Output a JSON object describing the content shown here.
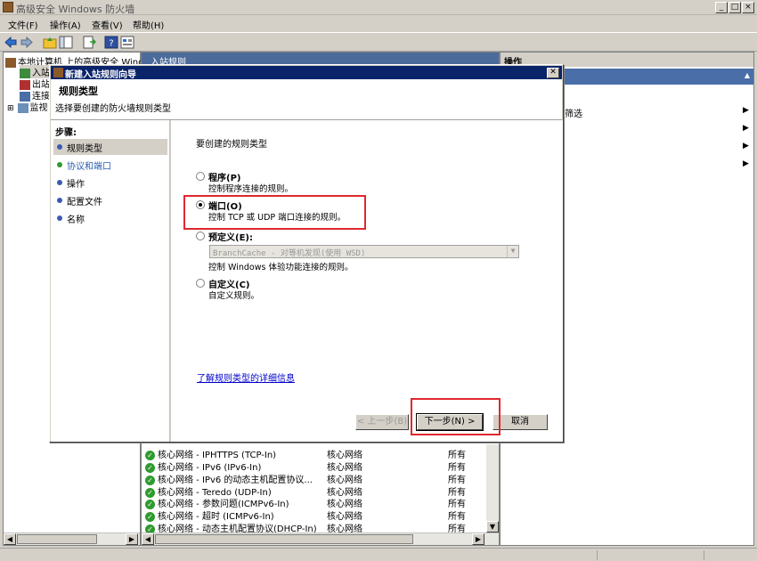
{
  "window": {
    "title": "高级安全 Windows 防火墙",
    "controls": [
      "_",
      "□",
      "×"
    ]
  },
  "menu": [
    "文件(F)",
    "操作(A)",
    "查看(V)",
    "帮助(H)"
  ],
  "tree": {
    "root": "本地计算机 上的高级安全 Wind",
    "children": [
      "入站",
      "出站",
      "连接",
      "监视"
    ]
  },
  "center": {
    "header": "入站规则",
    "rows": [
      {
        "name": "核心网络 - IPHTTPS (TCP-In)",
        "group": "核心网络",
        "profile": "所有"
      },
      {
        "name": "核心网络 - IPv6 (IPv6-In)",
        "group": "核心网络",
        "profile": "所有"
      },
      {
        "name": "核心网络 - IPv6 的动态主机配置协议...",
        "group": "核心网络",
        "profile": "所有"
      },
      {
        "name": "核心网络 - Teredo (UDP-In)",
        "group": "核心网络",
        "profile": "所有"
      },
      {
        "name": "核心网络 - 参数问题(ICMPv6-In)",
        "group": "核心网络",
        "profile": "所有"
      },
      {
        "name": "核心网络 - 超时 (ICMPv6-In)",
        "group": "核心网络",
        "profile": "所有"
      },
      {
        "name": "核心网络 - 动态主机配置协议(DHCP-In)",
        "group": "核心网络",
        "profile": "所有"
      }
    ]
  },
  "right": {
    "header": "操作",
    "item_filter": "筛选"
  },
  "dialog": {
    "title": "新建入站规则向导",
    "heading": "规则类型",
    "subheading": "选择要创建的防火墙规则类型",
    "steps_title": "步骤:",
    "steps": [
      "规则类型",
      "协议和端口",
      "操作",
      "配置文件",
      "名称"
    ],
    "prompt": "要创建的规则类型",
    "options": [
      {
        "label": "程序(P)",
        "desc": "控制程序连接的规则。"
      },
      {
        "label": "端口(O)",
        "desc": "控制 TCP 或 UDP 端口连接的规则。"
      },
      {
        "label": "预定义(E):",
        "desc": "控制 Windows 体验功能连接的规则。"
      },
      {
        "label": "自定义(C)",
        "desc": "自定义规则。"
      }
    ],
    "selected_option": 1,
    "predefined_value": "BranchCache - 对等机发现(使用 WSD)",
    "learn_more": "了解规则类型的详细信息",
    "buttons": {
      "back": "< 上一步(B)",
      "next": "下一步(N) >",
      "cancel": "取消"
    }
  }
}
